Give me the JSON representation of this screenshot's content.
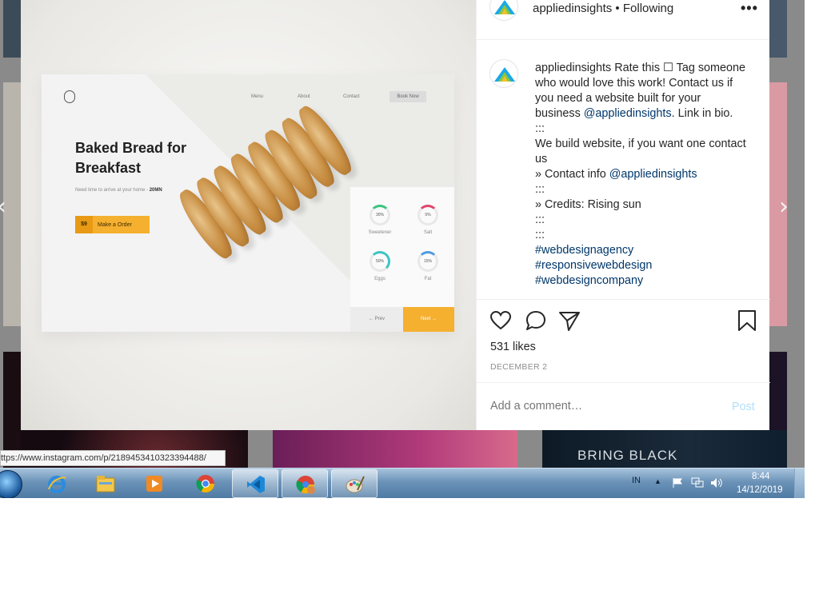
{
  "post": {
    "username": "appliedinsights",
    "follow_state": "Following",
    "separator": "•",
    "more_label": "•••",
    "caption": {
      "username": "appliedinsights",
      "line1": "Rate this ☐ Tag someone who would love this work! Contact us if you need a website built for your business",
      "mention1": "@appliedinsights",
      "line1_end": ". Link in bio.",
      "sep1": ":::",
      "line2": "We build website, if you want one contact us",
      "contact_prefix": "» Contact info",
      "mention2": "@appliedinsights",
      "sep2": ":::",
      "credits": "» Credits: Rising sun",
      "sep3": ":::",
      "sep4": ":::",
      "hashtags": [
        "#webdesignagency",
        "#responsivewebdesign",
        "#webdesigncompany"
      ]
    },
    "likes": "531 likes",
    "date": "DECEMBER 2",
    "comment_placeholder": "Add a comment…",
    "post_label": "Post"
  },
  "mockup": {
    "menu": [
      "Menu",
      "About",
      "Contact"
    ],
    "book_now": "Book Now",
    "title": "Baked Bread for Breakfast",
    "subtitle_prefix": "Need time to arrive at your home - ",
    "subtitle_time": "20MN",
    "price": "$9",
    "order_label": "Make a Order",
    "nutrients": [
      {
        "value": "30%",
        "label": "Sweetener",
        "color": "#3cc47c"
      },
      {
        "value": "5%",
        "label": "Salt",
        "color": "#e0456b"
      },
      {
        "value": "50%",
        "label": "Eggs",
        "color": "#3cc4c4"
      },
      {
        "value": "15%",
        "label": "Fat",
        "color": "#4f9be0"
      }
    ],
    "prev_label": "Prev",
    "next_label": "Next",
    "accent": "#f5b02f"
  },
  "background": {
    "tile_text": "BRING BLACK"
  },
  "status_url": "ttps://www.instagram.com/p/2189453410323394488/",
  "taskbar": {
    "language": "IN",
    "time": "8:44",
    "date": "14/12/2019",
    "apps": [
      "internet-explorer",
      "file-explorer",
      "media-player",
      "chrome",
      "vscode",
      "chrome-paint",
      "paint"
    ]
  }
}
